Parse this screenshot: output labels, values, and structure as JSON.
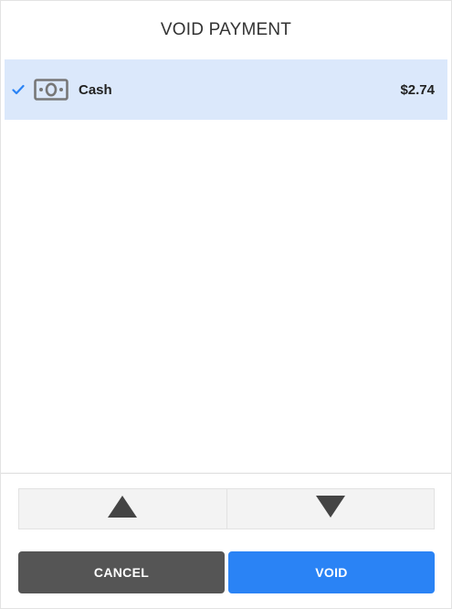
{
  "dialog": {
    "title": "VOID PAYMENT"
  },
  "payments": [
    {
      "selected": true,
      "check_icon": "checkmark-icon",
      "method_icon": "cash-icon",
      "method": "Cash",
      "amount": "$2.74"
    }
  ],
  "scroll": {
    "up_icon": "triangle-up-icon",
    "down_icon": "triangle-down-icon"
  },
  "actions": {
    "cancel_label": "CANCEL",
    "void_label": "VOID"
  },
  "colors": {
    "selected_row": "#dbe8fb",
    "check_accent": "#2a83f5",
    "cancel_button": "#555555",
    "void_button": "#2a83f5",
    "arrow": "#444444"
  }
}
